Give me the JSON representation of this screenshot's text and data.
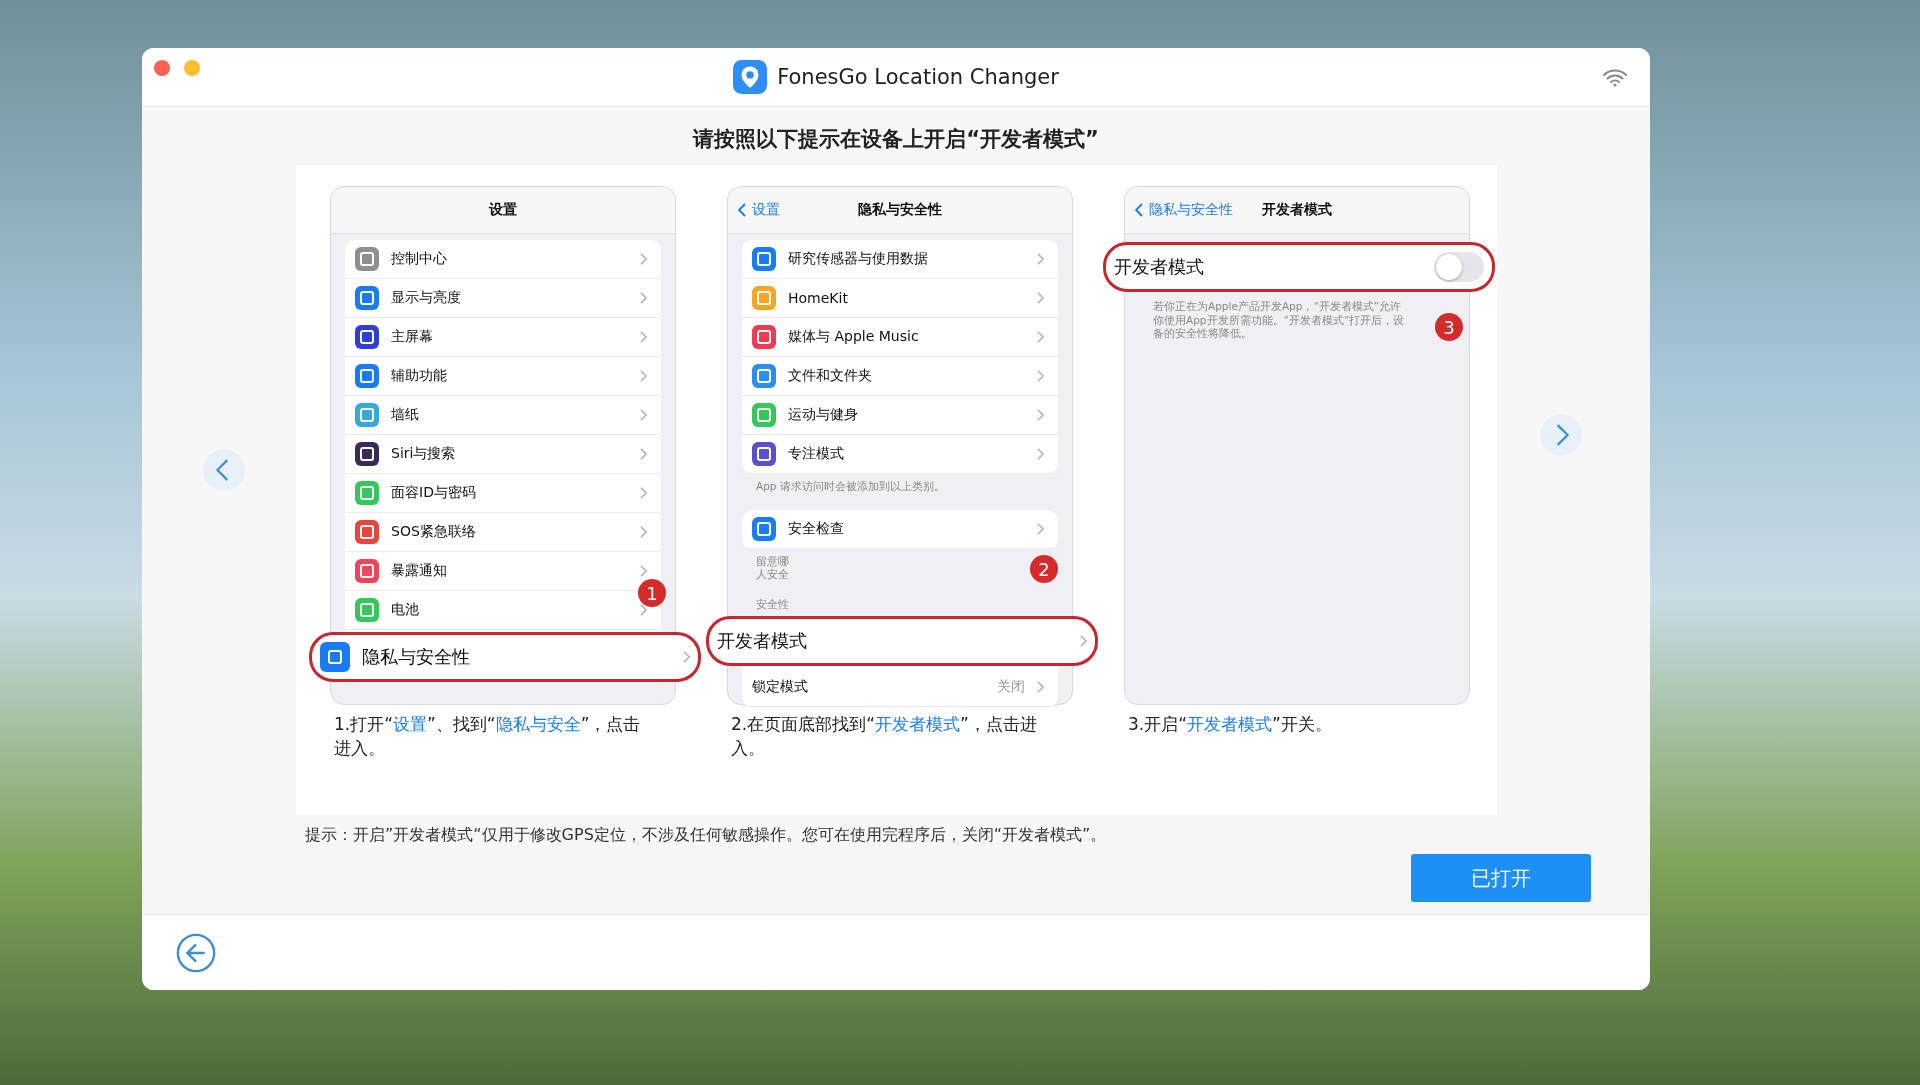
{
  "window": {
    "title": "FonesGo Location Changer"
  },
  "heading": "请按照以下提示在设备上开启“开发者模式”",
  "steps": [
    {
      "title": "设置",
      "badge": "1",
      "sections": [
        {
          "rows": [
            {
              "kind": "link",
              "label": "控制中心",
              "color": "#8e8e93",
              "highlighted": false
            },
            {
              "kind": "link",
              "label": "显示与亮度",
              "color": "#1a7cf5",
              "highlighted": false
            },
            {
              "kind": "link",
              "label": "主屏幕",
              "color": "#2f3fd6",
              "highlighted": false
            },
            {
              "kind": "link",
              "label": "辅助功能",
              "color": "#1a7cf5",
              "highlighted": false
            },
            {
              "kind": "link",
              "label": "墙纸",
              "color": "#37a8dc",
              "highlighted": false
            },
            {
              "kind": "link",
              "label": "Siri与搜索",
              "color": "#3a2a55",
              "highlighted": false
            },
            {
              "kind": "link",
              "label": "面容ID与密码",
              "color": "#34c759",
              "highlighted": false
            },
            {
              "kind": "link",
              "label": "SOS紧急联络",
              "color": "#e8453c",
              "highlighted": false
            },
            {
              "kind": "link",
              "label": "暴露通知",
              "color": "#f0445a",
              "highlighted": false
            },
            {
              "kind": "link",
              "label": "电池",
              "color": "#34c759",
              "highlighted": false
            },
            {
              "kind": "link",
              "label": "隐私与安全性",
              "color": "#1a7cf5",
              "highlighted": true
            }
          ]
        }
      ],
      "caption": [
        {
          "text": "1.打开“",
          "accent": false
        },
        {
          "text": "设置",
          "accent": true
        },
        {
          "text": "”、找到“",
          "accent": false
        },
        {
          "text": "隐私与安全",
          "accent": true
        },
        {
          "text": "”，点击",
          "accent": false
        },
        {
          "text": "进入。",
          "accent": false
        }
      ]
    },
    {
      "back": "设置",
      "title": "隐私与安全性",
      "badge": "2",
      "sections": [
        {
          "rows": [
            {
              "kind": "link",
              "label": "研究传感器与使用数据",
              "color": "#1a7cf5",
              "highlighted": false
            },
            {
              "kind": "link",
              "label": "HomeKit",
              "color": "#f5a623",
              "highlighted": false
            },
            {
              "kind": "link",
              "label": "媒体与 Apple Music",
              "color": "#f23a50",
              "highlighted": false
            },
            {
              "kind": "link",
              "label": "文件和文件夹",
              "color": "#2d8ef0",
              "highlighted": false
            },
            {
              "kind": "link",
              "label": "运动与健身",
              "color": "#34c759",
              "highlighted": false
            },
            {
              "kind": "link",
              "label": "专注模式",
              "color": "#5a4fcf",
              "highlighted": false
            }
          ],
          "footer": [
            "App 请求访问时会被添加到以上类别。"
          ]
        },
        {
          "rows": [
            {
              "kind": "link",
              "label": "安全检查",
              "color": "#1a7cf5",
              "highlighted": false
            }
          ],
          "footer": [
            "留意哪",
            "人安全"
          ]
        },
        {
          "header": "安全性",
          "rows": [
            {
              "kind": "link",
              "label": "开发者模式",
              "highlighted": true
            },
            {
              "kind": "link",
              "label": "锁定模式",
              "value": "关闭",
              "highlighted": false
            }
          ]
        }
      ],
      "caption": [
        {
          "text": "2.在页面底部找到“",
          "accent": false
        },
        {
          "text": "开发者模式",
          "accent": true
        },
        {
          "text": "”，点击进",
          "accent": false
        },
        {
          "text": "入。",
          "accent": false
        }
      ]
    },
    {
      "back": "隐私与安全性",
      "title": "开发者模式",
      "badge": "3",
      "sections": [
        {
          "rows": [
            {
              "kind": "toggle",
              "label": "开发者模式",
              "on": false,
              "highlighted": true
            }
          ],
          "footer": [
            "若你正在为Apple产品开发App，“开发者模式”允许你使用App开发所需功能。“开发者模式”打开后，设备的安全性将降低。"
          ]
        }
      ],
      "caption": [
        {
          "text": "3.开启“",
          "accent": false
        },
        {
          "text": "开发者模式",
          "accent": true
        },
        {
          "text": "”开关。",
          "accent": false
        }
      ]
    }
  ],
  "tip": "提示：开启”开发者模式“仅用于修改GPS定位，不涉及任何敏感操作。您可在使用完程序后，关闭“开发者模式”。",
  "confirm_button": "已打开"
}
